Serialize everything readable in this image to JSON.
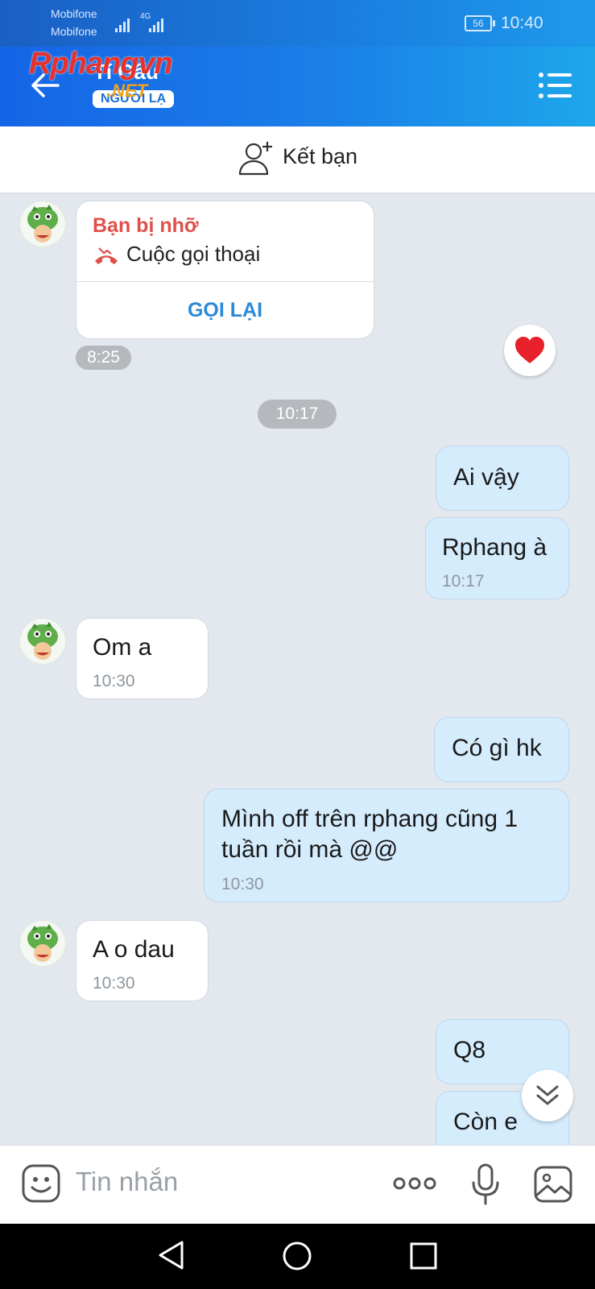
{
  "status_bar": {
    "carrier_1": "Mobifone",
    "carrier_2": "Mobifone",
    "network": "4G",
    "battery": "56",
    "time": "10:40"
  },
  "header": {
    "title": "Tí Gấu",
    "badge": "NGƯỜI LẠ",
    "watermark_main": "Rphangvn",
    "watermark_sub": ".NET",
    "back_icon": "back-arrow-icon",
    "menu_icon": "list-menu-icon"
  },
  "add_friend": {
    "label": "Kết bạn",
    "icon": "add-person-icon"
  },
  "missed_call": {
    "title": "Bạn bị nhỡ",
    "type": "Cuộc gọi thoại",
    "action": "GỌI LẠI",
    "time": "8:25",
    "icon": "missed-call-icon"
  },
  "reaction": {
    "icon": "heart-icon"
  },
  "time_separator": "10:17",
  "messages": [
    {
      "direction": "out",
      "text": "Ai vậy",
      "time": ""
    },
    {
      "direction": "out",
      "text": "Rphang à",
      "time": "10:17"
    },
    {
      "direction": "in",
      "text": "Om a",
      "time": "10:30"
    },
    {
      "direction": "out",
      "text": "Có gì hk",
      "time": ""
    },
    {
      "direction": "out",
      "text": "Mình off trên rphang cũng 1 tuần rồi mà @@",
      "time": "10:30"
    },
    {
      "direction": "in",
      "text": "A o dau",
      "time": "10:30"
    },
    {
      "direction": "out",
      "text": "Q8",
      "time": ""
    },
    {
      "direction": "out",
      "text": "Còn e",
      "time": ""
    }
  ],
  "input": {
    "placeholder": "Tin nhắn"
  },
  "colors": {
    "header_blue": "#1a7fe8",
    "bubble_out": "#d5ecfd",
    "missed_red": "#e0504a",
    "link_blue": "#2a8ad8"
  }
}
